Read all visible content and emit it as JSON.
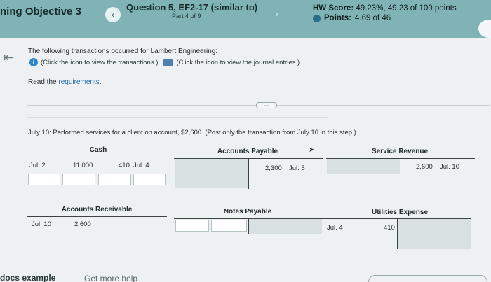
{
  "header": {
    "objective": "ning Objective 3",
    "question_title": "Question 5, EF2-17 (similar to)",
    "part": "Part 4 of 9",
    "hw_score_label": "HW Score:",
    "hw_score_value": "49.23%, 49.23 of 100 points",
    "points_label": "Points:",
    "points_value": "4.69 of 46",
    "prev_icon": "chevron-left-icon",
    "next_icon": "chevron-right-icon"
  },
  "content": {
    "intro": "The following transactions occurred for Lambert Engineering:",
    "transactions_link": "(Click the icon to view the transactions.)",
    "journal_link": "(Click the icon to view the journal entries.)",
    "read_prefix": "Read the ",
    "requirements_link": "requirements",
    "read_suffix": ".",
    "divider_dots": "....",
    "step": "July 10: Performed services for a client on account, $2,600. (Post only the transaction from July 10 in this step.)"
  },
  "accounts": {
    "cash": {
      "title": "Cash",
      "left_date": "Jul. 2",
      "left_amount": "11,000",
      "right_amount": "410",
      "right_date": "Jul. 4"
    },
    "accounts_payable": {
      "title": "Accounts Payable",
      "right_amount": "2,300",
      "right_date": "Jul. 5"
    },
    "service_revenue": {
      "title": "Service Revenue",
      "right_amount": "2,600",
      "right_date": "Jul. 10"
    },
    "accounts_receivable": {
      "title": "Accounts Receivable",
      "left_date": "Jul. 10",
      "left_amount": "2,600"
    },
    "notes_payable": {
      "title": "Notes Payable"
    },
    "utilities_expense": {
      "title": "Utilities Expense",
      "left_date": "Jul. 4",
      "left_amount": "410"
    }
  },
  "footer": {
    "left": "docs example",
    "mid": "Get more help"
  }
}
